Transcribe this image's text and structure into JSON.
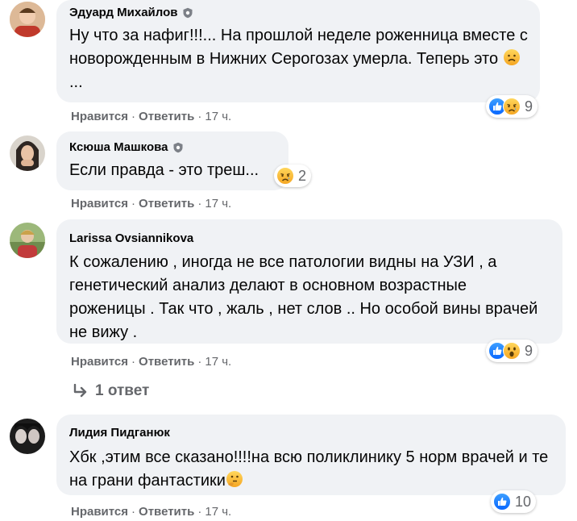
{
  "comments": [
    {
      "author": "Эдуард Михайлов",
      "text": "Ну что за нафиг!!!... На прошлой неделе роженница вместе с новорожденным в Нижних Серогозах умерла. Теперь это",
      "text_suffix": "...",
      "like": "Нравится",
      "reply": "Ответить",
      "time": "17 ч.",
      "reaction_count": "9",
      "reactions": [
        "like-icon",
        "sad-icon"
      ]
    },
    {
      "author": "Ксюша Машкова",
      "text": "Если правда - это треш...",
      "like": "Нравится",
      "reply": "Ответить",
      "time": "17 ч.",
      "reaction_count": "2",
      "reactions": [
        "sad-icon"
      ]
    },
    {
      "author": "Larissa Ovsiannikova",
      "text": "К сожалению , иногда не все патологии видны на УЗИ , а генетический анализ делают в основном возрастные роженицы . Так что , жаль , нет слов .. Но особой вины врачей не вижу .",
      "like": "Нравится",
      "reply": "Ответить",
      "time": "17 ч.",
      "reaction_count": "9",
      "reactions": [
        "like-icon",
        "wow-icon"
      ],
      "replies_label": "1 ответ"
    },
    {
      "author": "Лидия Пидганюк",
      "text": "Хбк ,этим все сказано!!!!на всю поликлинику 5 норм врачей и те на грани фантастики",
      "like": "Нравится",
      "reply": "Ответить",
      "time": "17 ч.",
      "reaction_count": "10",
      "reactions": [
        "like-icon"
      ]
    }
  ],
  "colors": {
    "bubble": "#f0f2f5",
    "meta": "#65676b",
    "like_blue": "#1877f2",
    "emoji_yellow": "#f7b125"
  }
}
